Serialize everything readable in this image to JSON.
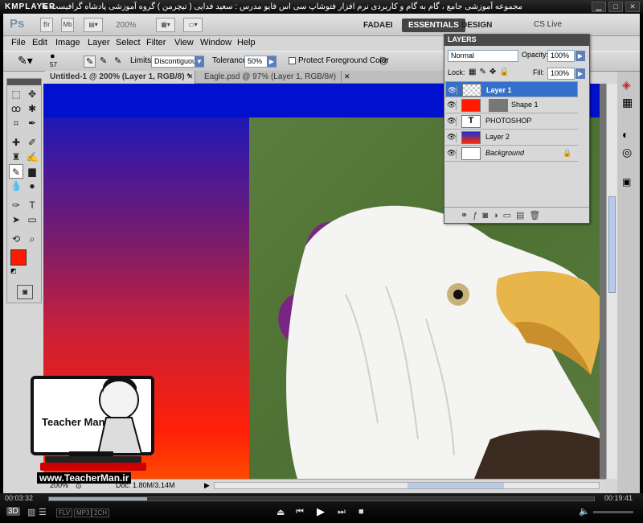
{
  "player": {
    "name": "KMPLAYER",
    "title": "مجموعه آموزشی جامع ، گام به گام و کاربردی نرم افزار فتوشاپ سی اس فایو  مدرس : سعید فدایی ( تیچرمن ) گروه آموزشی پادشاه گرافیست ها",
    "time_current": "00:03:32",
    "time_total": "00:19:41",
    "badge_3d": "3D",
    "codecs": [
      "FLV",
      "MP3",
      "2CH"
    ]
  },
  "app": {
    "logo": "Ps",
    "bridge": "Br",
    "minibridge": "Mb",
    "zoom": "200%",
    "workspaces": [
      "FADAEI",
      "ESSENTIALS",
      "DESIGN"
    ],
    "cs_live": "CS Live"
  },
  "menu": [
    "File",
    "Edit",
    "Image",
    "Layer",
    "Select",
    "Filter",
    "View",
    "Window",
    "Help"
  ],
  "options": {
    "brush_size": "57",
    "limits_label": "Limits:",
    "limits_value": "Discontiguous",
    "tolerance_label": "Tolerance:",
    "tolerance_value": "50%",
    "protect_label": "Protect Foreground Color"
  },
  "tabs": [
    {
      "label": "Untitled-1 @ 200% (Layer 1, RGB/8) *"
    },
    {
      "label": "Eagle.psd @ 97% (Layer 1, RGB/8#)"
    }
  ],
  "status": {
    "zoom": "200%",
    "doc": "Doc: 1.80M/3.14M"
  },
  "layers_panel": {
    "title": "LAYERS",
    "blend_mode": "Normal",
    "opacity_label": "Opacity:",
    "opacity_value": "100%",
    "lock_label": "Lock:",
    "fill_label": "Fill:",
    "fill_value": "100%",
    "layers": [
      {
        "name": "Layer 1",
        "selected": true,
        "thumb": "checker"
      },
      {
        "name": "Shape 1",
        "selected": false,
        "thumb": "shape"
      },
      {
        "name": "PHOTOSHOP",
        "selected": false,
        "thumb": "text"
      },
      {
        "name": "Layer 2",
        "selected": false,
        "thumb": "gradient"
      },
      {
        "name": "Background",
        "selected": false,
        "thumb": "white"
      }
    ]
  },
  "watermark": {
    "brand": "Teacher Man",
    "url": "www.TeacherMan.ir"
  },
  "colors": {
    "foreground": "#ff1a00",
    "background": "#ffffff",
    "accent": "#3470c9"
  }
}
